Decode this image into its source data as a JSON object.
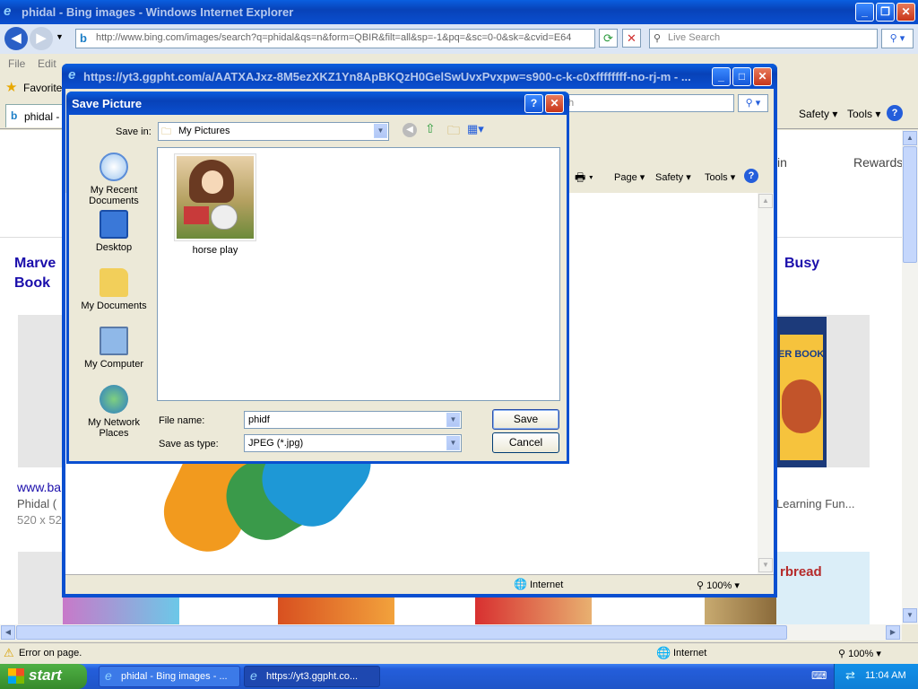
{
  "ie_main": {
    "title": "phidal - Bing images - Windows Internet Explorer",
    "address": "http://www.bing.com/images/search?q=phidal&qs=n&form=QBIR&filt=all&sp=-1&pq=&sc=0-0&sk=&cvid=E64",
    "search_placeholder": "Live Search",
    "menu": [
      "File",
      "Edit"
    ],
    "favorites": "Favorites",
    "tab_label": "phidal - B",
    "toolbar": [
      "Safety",
      "Tools"
    ],
    "status_left": "Error on page.",
    "status_zone": "Internet",
    "zoom": "100%"
  },
  "bing": {
    "rewards": "Rewards",
    "sign_in": "in",
    "left_title_1": "Marve",
    "left_title_2": "Book",
    "right_title": "Busy",
    "left_link": "www.ba",
    "left_meta_1": "Phidal (",
    "left_meta_2": "520 x 52",
    "right_meta": "Learning Fun...",
    "right_book": "ER BOOK",
    "gingerbread": "rbread"
  },
  "popup": {
    "title": "https://yt3.ggpht.com/a/AATXAJxz-8M5ezXKZ1Yn8ApBKQzH0GelSwUvxPvxpw=s900-c-k-c0xffffffff-no-rj-m - ...",
    "search_text": "h",
    "toolbar": [
      "Page",
      "Safety",
      "Tools"
    ],
    "status_zone": "Internet",
    "zoom": "100%"
  },
  "dialog": {
    "title": "Save Picture",
    "save_in_label": "Save in:",
    "save_in_value": "My Pictures",
    "places": [
      "My Recent Documents",
      "Desktop",
      "My Documents",
      "My Computer",
      "My Network Places"
    ],
    "file_item": "horse play",
    "file_name_label": "File name:",
    "file_name_value": "phidf",
    "save_type_label": "Save as type:",
    "save_type_value": "JPEG (*.jpg)",
    "save_button": "Save",
    "cancel_button": "Cancel"
  },
  "taskbar": {
    "start": "start",
    "items": [
      "phidal - Bing images - ...",
      "https://yt3.ggpht.co..."
    ],
    "clock": "11:04 AM"
  },
  "colors": {
    "xp_blue": "#0a4fd0",
    "taskbar": "#245edb",
    "start_green": "#3c9a32",
    "bing_link": "#1a0dab"
  }
}
